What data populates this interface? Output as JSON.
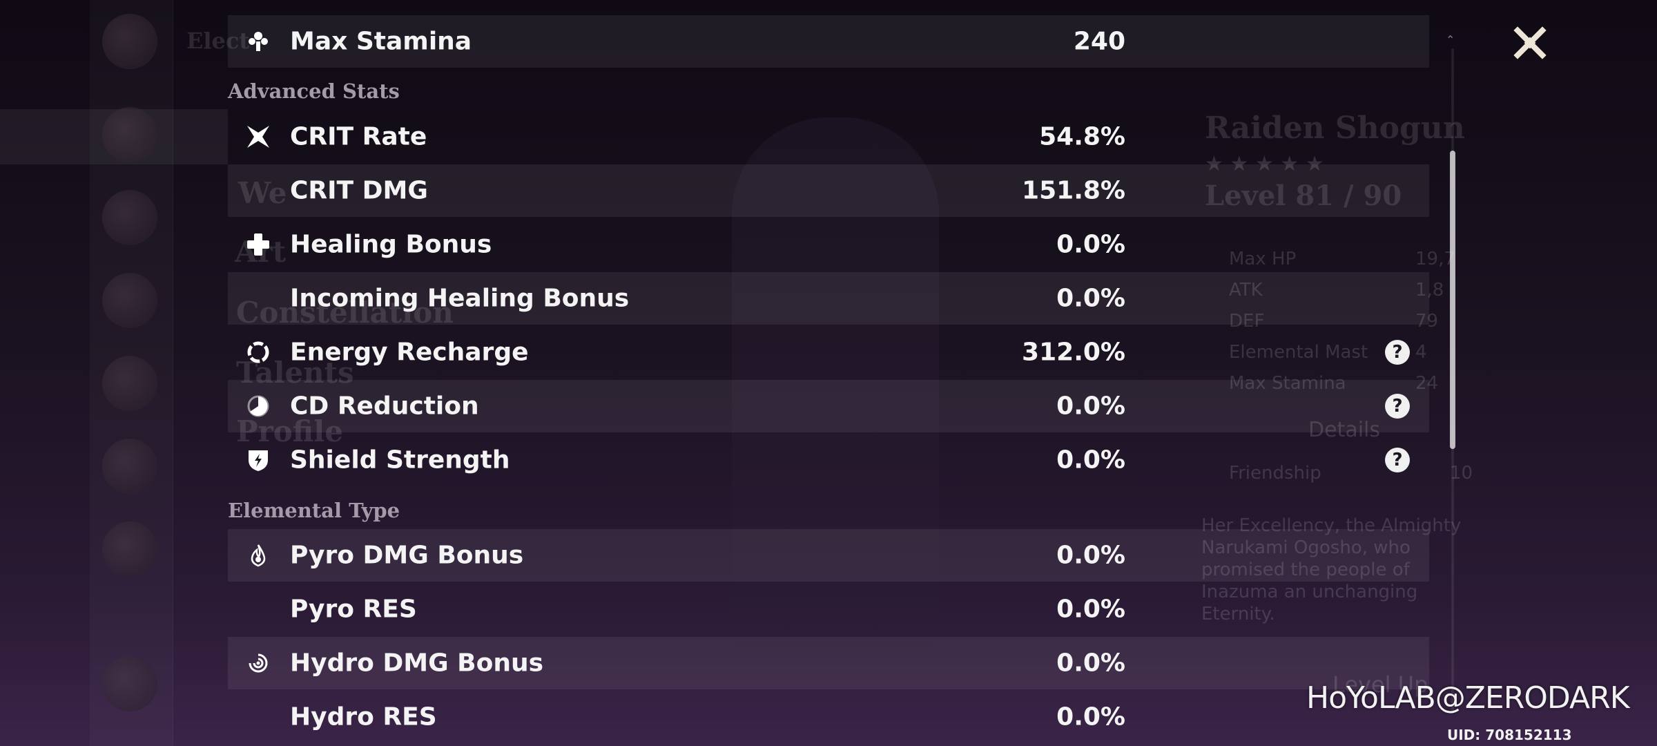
{
  "background": {
    "menu_labels": [
      "Elect",
      "We",
      "Art",
      "Constellation",
      "Talents",
      "Profile"
    ],
    "character": {
      "name": "Raiden Shogun",
      "stars": "★ ★ ★ ★ ★",
      "level": "Level 81 / 90",
      "stats": [
        {
          "label": "Max HP",
          "value": "19,7"
        },
        {
          "label": "ATK",
          "value": "1,8"
        },
        {
          "label": "DEF",
          "value": "79"
        },
        {
          "label": "Elemental Mast",
          "value": "4"
        },
        {
          "label": "Max Stamina",
          "value": "24"
        }
      ],
      "details_label": "Details",
      "friendship_label": "Friendship",
      "friendship_value": "10",
      "description": "Her Excellency, the Almighty Narukami Ogosho, who promised the people of Inazuma an unchanging Eternity.",
      "level_up_label": "Level Up"
    }
  },
  "stats_panel": {
    "top_row": {
      "name": "Max Stamina",
      "value": "240",
      "icon": "stamina-icon"
    },
    "advanced_header": "Advanced Stats",
    "advanced": [
      {
        "name": "CRIT Rate",
        "value": "54.8%",
        "icon": "crit-rate-icon",
        "help": false
      },
      {
        "name": "CRIT DMG",
        "value": "151.8%",
        "icon": "",
        "help": false
      },
      {
        "name": "Healing Bonus",
        "value": "0.0%",
        "icon": "healing-cross-icon",
        "help": false
      },
      {
        "name": "Incoming Healing Bonus",
        "value": "0.0%",
        "icon": "",
        "help": false
      },
      {
        "name": "Energy Recharge",
        "value": "312.0%",
        "icon": "energy-recharge-icon",
        "help": true
      },
      {
        "name": "CD Reduction",
        "value": "0.0%",
        "icon": "cd-reduction-icon",
        "help": true
      },
      {
        "name": "Shield Strength",
        "value": "0.0%",
        "icon": "shield-icon",
        "help": true
      }
    ],
    "elemental_header": "Elemental Type",
    "elemental": [
      {
        "name": "Pyro DMG Bonus",
        "value": "0.0%",
        "icon": "pyro-icon"
      },
      {
        "name": "Pyro RES",
        "value": "0.0%",
        "icon": ""
      },
      {
        "name": "Hydro DMG Bonus",
        "value": "0.0%",
        "icon": "hydro-icon"
      },
      {
        "name": "Hydro RES",
        "value": "0.0%",
        "icon": ""
      }
    ],
    "help_glyph": "?"
  },
  "close_glyph": "✕",
  "watermark": "HoYoLAB@ZERODARK",
  "uid": "UID: 708152113"
}
